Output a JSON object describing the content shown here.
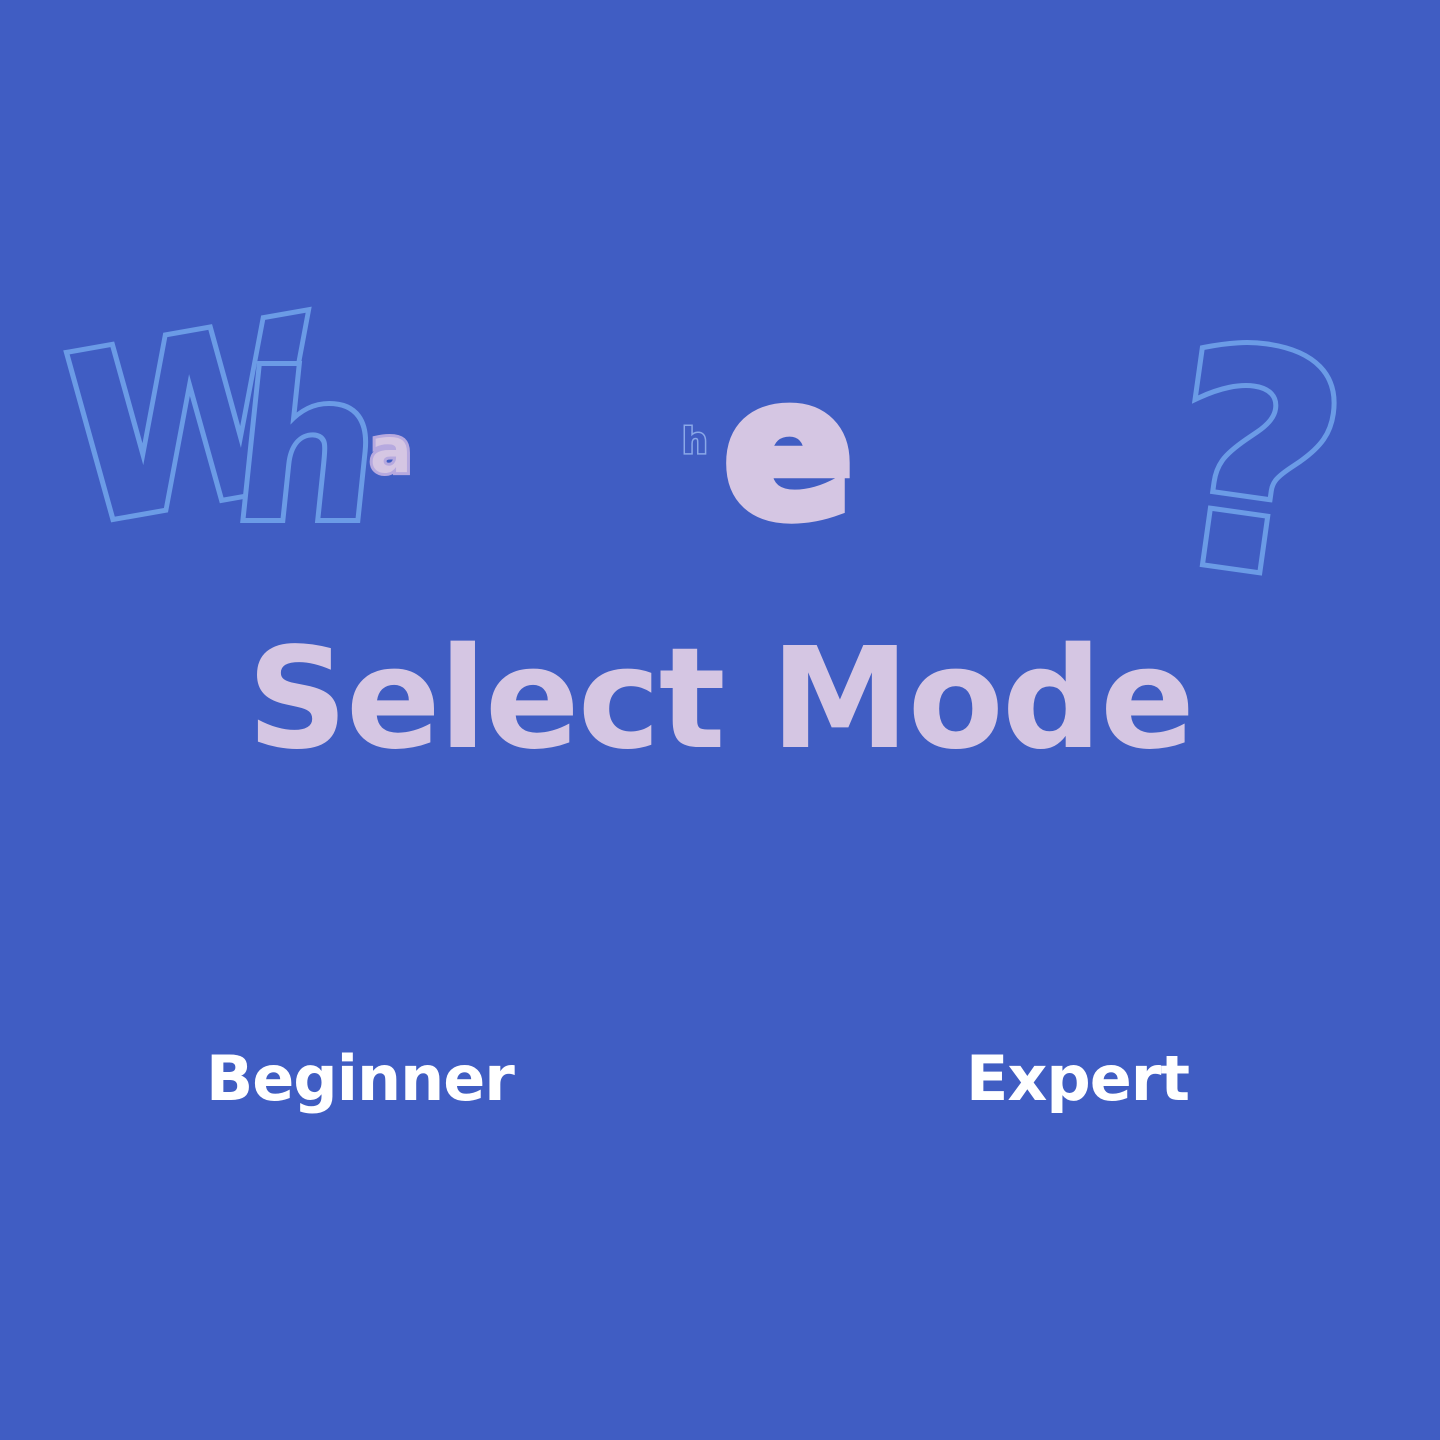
{
  "background_color": "#405dc3",
  "decor": {
    "letters_w": "W",
    "letters_h": "h",
    "letter_a": "a",
    "letter_small_h": "h",
    "letter_e": "e",
    "question_mark": "?"
  },
  "title": "Select Mode",
  "modes": {
    "beginner_label": "Beginner",
    "expert_label": "Expert"
  },
  "colors": {
    "outline_blue": "#6b9be6",
    "lilac": "#d5c6e3",
    "button_text": "#ffffff"
  }
}
